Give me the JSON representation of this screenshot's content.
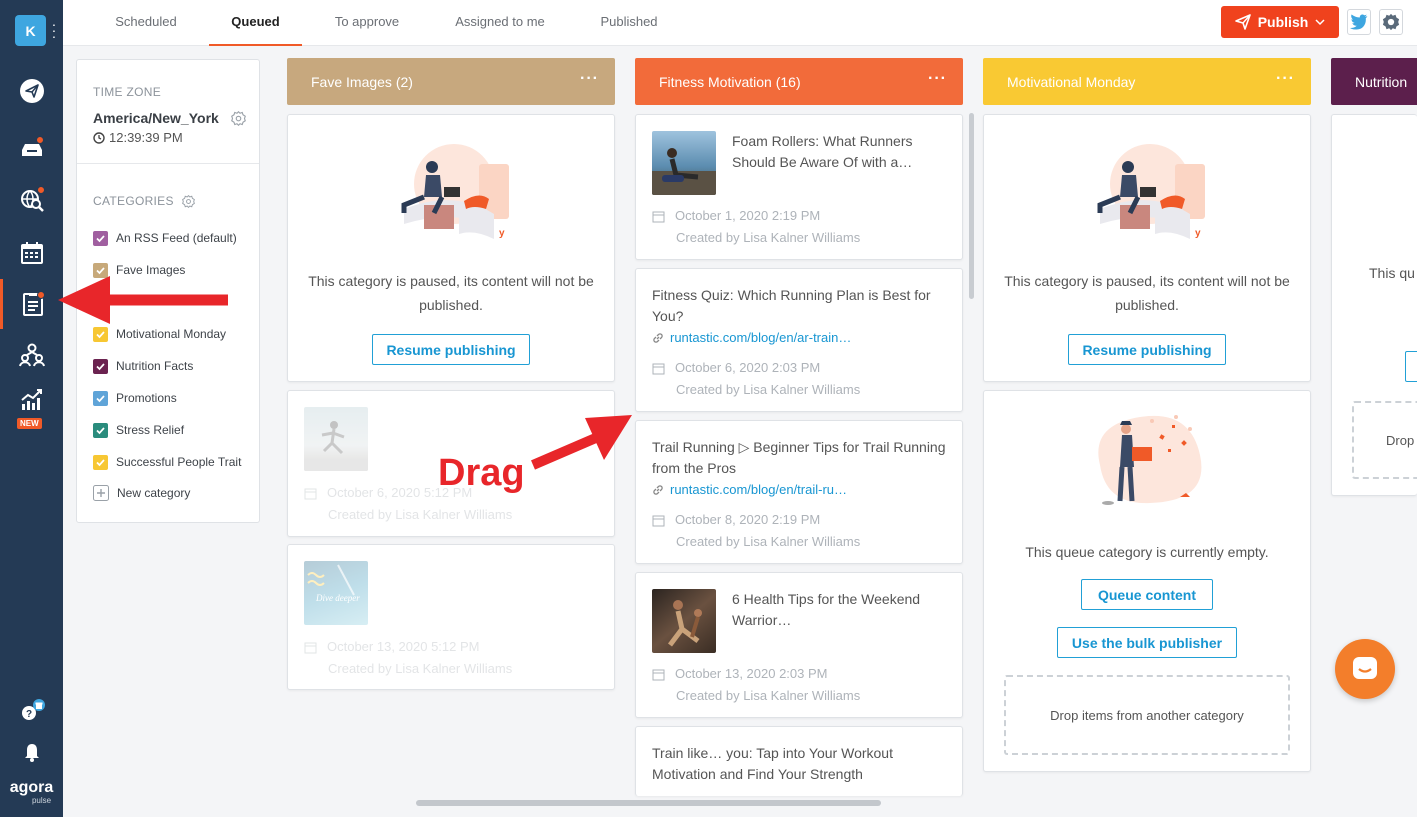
{
  "sidebar": {
    "account_initial": "K",
    "new_badge": "NEW",
    "logo_main": "agora",
    "logo_sub": "pulse"
  },
  "tabs": [
    {
      "label": "Scheduled"
    },
    {
      "label": "Queued"
    },
    {
      "label": "To approve"
    },
    {
      "label": "Assigned to me"
    },
    {
      "label": "Published"
    }
  ],
  "header": {
    "publish_label": "Publish"
  },
  "timezone": {
    "label": "TIME ZONE",
    "value": "America/New_York",
    "time": "12:39:39 PM"
  },
  "categories": {
    "label": "CATEGORIES",
    "items": [
      {
        "name": "An RSS Feed  (default)",
        "color": "#a05fa0"
      },
      {
        "name": "Fave Images",
        "color": "#c7a97a"
      },
      {
        "name": "",
        "color": "#f37d46"
      },
      {
        "name": "Motivational Monday",
        "color": "#f7c733"
      },
      {
        "name": "Nutrition Facts",
        "color": "#6b2350"
      },
      {
        "name": "Promotions",
        "color": "#5fa4d8"
      },
      {
        "name": "Stress Relief",
        "color": "#2a8c7d"
      },
      {
        "name": "Successful People Trait",
        "color": "#f7c733"
      }
    ],
    "new_label": "New category"
  },
  "columns": {
    "fave": {
      "title": "Fave Images  (2)",
      "color": "#c7a87e",
      "paused_text": "This category is paused, its content will not be published.",
      "resume_label": "Resume publishing",
      "posts": [
        {
          "date": "October 6, 2020 5:12 PM",
          "author": "Created by Lisa Kalner Williams"
        },
        {
          "date": "October 13, 2020 5:12 PM",
          "author": "Created by Lisa Kalner Williams",
          "thumb_text": "Dive deeper"
        }
      ]
    },
    "fitness": {
      "title": "Fitness Motivation  (16)",
      "color": "#f26b3a",
      "posts": [
        {
          "title": "Foam Rollers: What Runners Should Be Aware Of with a…",
          "date": "October 1, 2020 2:19 PM",
          "author": "Created by Lisa Kalner Williams"
        },
        {
          "title": "Fitness Quiz: Which Running Plan is Best for You?",
          "link": "runtastic.com/blog/en/ar-train…",
          "date": "October 6, 2020 2:03 PM",
          "author": "Created by Lisa Kalner Williams"
        },
        {
          "title": "Trail Running ▷ Beginner Tips for Trail Running from the Pros",
          "link": "runtastic.com/blog/en/trail-ru…",
          "date": "October 8, 2020 2:19 PM",
          "author": "Created by Lisa Kalner Williams"
        },
        {
          "title": "6 Health Tips for the Weekend Warrior…",
          "date": "October 13, 2020 2:03 PM",
          "author": "Created by Lisa Kalner Williams"
        },
        {
          "title": "Train like… you: Tap into Your Workout Motivation and Find Your Strength"
        }
      ]
    },
    "motivational": {
      "title": "Motivational Monday",
      "color": "#f9c933",
      "paused_text": "This category is paused, its content will not be published.",
      "resume_label": "Resume publishing",
      "empty_text": "This queue category is currently empty.",
      "queue_label": "Queue content",
      "bulk_label": "Use the bulk publisher",
      "drop_text": "Drop items from another category"
    },
    "nutrition": {
      "title": "Nutrition",
      "color": "#5c1f4c",
      "paused_text": "This qu",
      "drop_text": "Drop"
    }
  },
  "annotation": {
    "drag_text": "Drag"
  }
}
